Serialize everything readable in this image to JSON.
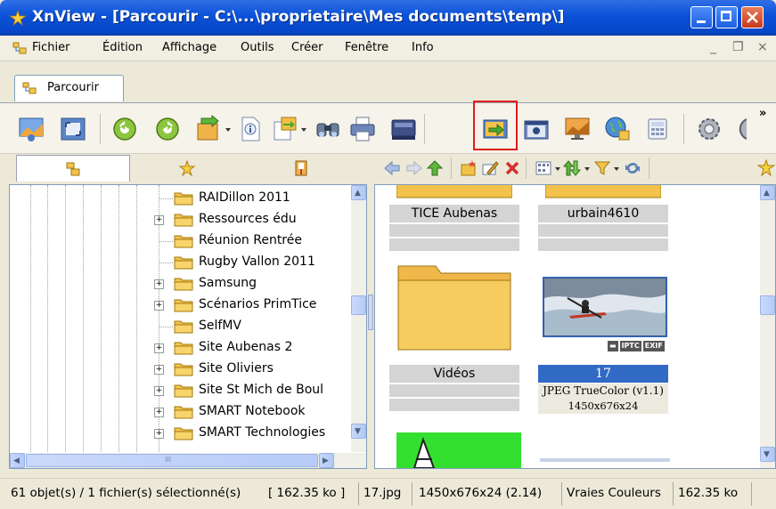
{
  "window": {
    "title": "XnView - [Parcourir - C:\\...\\proprietaire\\Mes documents\\temp\\]",
    "colors": {
      "titlebar": "#0a51d8",
      "selection": "#316ac5",
      "highlight_box": "#e21b1b"
    }
  },
  "menu": {
    "items": [
      "Fichier",
      "Édition",
      "Affichage",
      "Outils",
      "Créer",
      "Fenêtre",
      "Info"
    ],
    "mdi_min": "_",
    "mdi_restore": "❐",
    "mdi_close": "×"
  },
  "tabs": [
    {
      "label": "Parcourir",
      "icon": "browse-icon"
    }
  ],
  "toolbar": {
    "overflow": "»",
    "buttons": [
      "slideshow-icon",
      "fullscreen-icon",
      "rotate-left-icon",
      "rotate-right-icon",
      "convert-icon",
      "file-info-icon",
      "copy-to-icon",
      "find-icon",
      "print-icon",
      "scan-icon",
      "move-to-icon",
      "capture-icon",
      "wallpaper-icon",
      "web-icon",
      "calculator-icon",
      "settings-icon"
    ],
    "highlighted_button": "move-to-icon"
  },
  "left_tabs": [
    "folders-icon",
    "favorites-icon",
    "categories-icon"
  ],
  "nav_toolbar": {
    "buttons": [
      "back-icon",
      "forward-icon",
      "up-icon",
      "new-folder-icon",
      "rename-icon",
      "delete-icon",
      "view-mode-icon",
      "sort-icon",
      "filter-icon",
      "refresh-icon",
      "star-icon"
    ]
  },
  "tree": {
    "items": [
      {
        "label": "RAIDillon 2011",
        "expandable": false
      },
      {
        "label": "Ressources édu",
        "expandable": true
      },
      {
        "label": "Réunion Rentrée",
        "expandable": false
      },
      {
        "label": "Rugby Vallon 2011",
        "expandable": false
      },
      {
        "label": "Samsung",
        "expandable": true
      },
      {
        "label": "Scénarios PrimTice",
        "expandable": true
      },
      {
        "label": "SelfMV",
        "expandable": false
      },
      {
        "label": "Site Aubenas 2",
        "expandable": true
      },
      {
        "label": "Site Oliviers",
        "expandable": true
      },
      {
        "label": "Site St Mich de Boul",
        "expandable": true
      },
      {
        "label": "SMART Notebook",
        "expandable": true
      },
      {
        "label": "SMART Technologies",
        "expandable": true
      }
    ],
    "expand_glyph": "+",
    "scroll_grip": "III"
  },
  "browser": {
    "tiles": [
      {
        "name": "TICE Aubenas",
        "kind": "folder"
      },
      {
        "name": "urbain4610",
        "kind": "folder"
      },
      {
        "name": "Vidéos",
        "kind": "folder"
      },
      {
        "name": "17",
        "kind": "image",
        "selected": true,
        "format": "JPEG TrueColor (v1.1)",
        "dimensions": "1450x676x24",
        "badges": [
          "IPTC",
          "EXIF"
        ]
      }
    ]
  },
  "status": {
    "objects": "61 objet(s) / 1 fichier(s) sélectionné(s)",
    "selection_size": "[ 162.35 ko ]",
    "filename": "17.jpg",
    "image_info": "1450x676x24 (2.14)",
    "color_mode": "Vraies Couleurs",
    "file_size": "162.35 ko"
  }
}
